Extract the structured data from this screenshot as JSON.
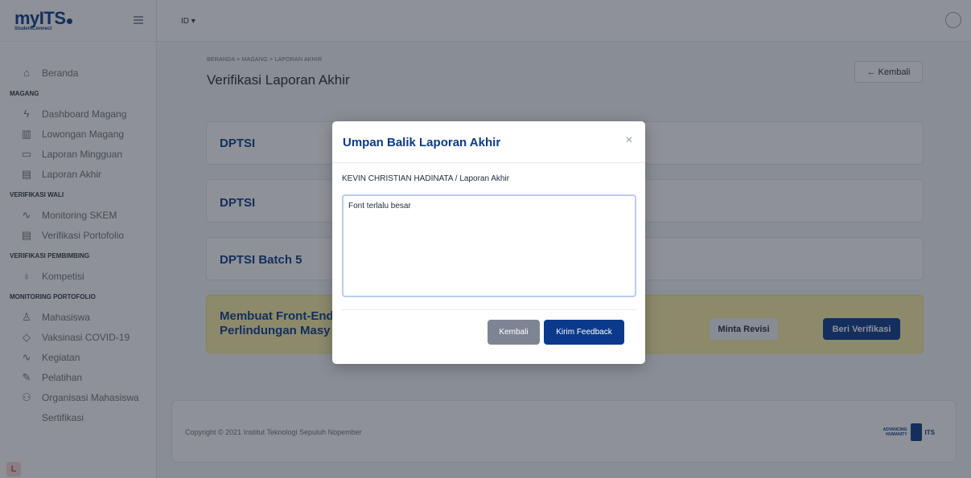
{
  "brand": {
    "name": "myITS",
    "sub": "StudentConnect"
  },
  "header": {
    "language": "ID ▾"
  },
  "sidebar": {
    "items": [
      {
        "type": "item",
        "icon": "home-icon",
        "glyph": "⌂",
        "label": "Beranda"
      },
      {
        "type": "section",
        "label": "MAGANG"
      },
      {
        "type": "item",
        "icon": "lightning-icon",
        "glyph": "ϟ",
        "label": "Dashboard Magang"
      },
      {
        "type": "item",
        "icon": "briefcase-icon",
        "glyph": "▥",
        "label": "Lowongan Magang"
      },
      {
        "type": "item",
        "icon": "calendar-icon",
        "glyph": "▭",
        "label": "Laporan Mingguan"
      },
      {
        "type": "item",
        "icon": "document-icon",
        "glyph": "▤",
        "label": "Laporan Akhir"
      },
      {
        "type": "section",
        "label": "VERIFIKASI WALI"
      },
      {
        "type": "item",
        "icon": "activity-icon",
        "glyph": "∿",
        "label": "Monitoring SKEM"
      },
      {
        "type": "item",
        "icon": "document-icon",
        "glyph": "▤",
        "label": "Verifikasi Portofolio"
      },
      {
        "type": "section",
        "label": "VERIFIKASI PEMBIMBING"
      },
      {
        "type": "item",
        "icon": "award-icon",
        "glyph": "♁",
        "label": "Kompetisi"
      },
      {
        "type": "section",
        "label": "MONITORING PORTOFOLIO"
      },
      {
        "type": "item",
        "icon": "user-icon",
        "glyph": "♙",
        "label": "Mahasiswa"
      },
      {
        "type": "item",
        "icon": "vaccine-icon",
        "glyph": "◇",
        "label": "Vaksinasi COVID-19"
      },
      {
        "type": "item",
        "icon": "activity-icon",
        "glyph": "∿",
        "label": "Kegiatan"
      },
      {
        "type": "item",
        "icon": "pen-icon",
        "glyph": "✎",
        "label": "Pelatihan"
      },
      {
        "type": "item",
        "icon": "users-icon",
        "glyph": "⚇",
        "label": "Organisasi Mahasiswa"
      },
      {
        "type": "item",
        "icon": "certificate-icon",
        "glyph": "",
        "label": "Sertifikasi"
      }
    ]
  },
  "main": {
    "breadcrumb": "BERANDA  >  MAGANG  >  LAPORAN AKHIR",
    "title": "Verifikasi Laporan Akhir",
    "back_label": "← Kembali",
    "cards": [
      {
        "title": "DPTSI"
      },
      {
        "title": "DPTSI"
      },
      {
        "title": "DPTSI Batch 5"
      }
    ],
    "highlight_card": {
      "title_line1": "Membuat Front-End",
      "title_line2": "Perlindungan Masy",
      "revisi_label": "Minta Revisi",
      "verif_label": "Beri Verifikasi"
    }
  },
  "footer": {
    "copyright": "Copyright © 2021 Institut Teknologi Sepuluh Nopember",
    "logo_line1": "ADVANCING",
    "logo_line2": "HUMANITY",
    "logo_its": "ITS"
  },
  "modal": {
    "title": "Umpan Balik Laporan Akhir",
    "close_glyph": "×",
    "student_line": "KEVIN CHRISTIAN HADINATA / Laporan Akhir",
    "feedback_value": "Font terlalu besar",
    "cancel_label": "Kembali",
    "submit_label": "Kirim Feedback"
  },
  "colors": {
    "primary": "#0b3a8c",
    "highlight": "#fbf1a6",
    "cancel": "#7d8595"
  }
}
